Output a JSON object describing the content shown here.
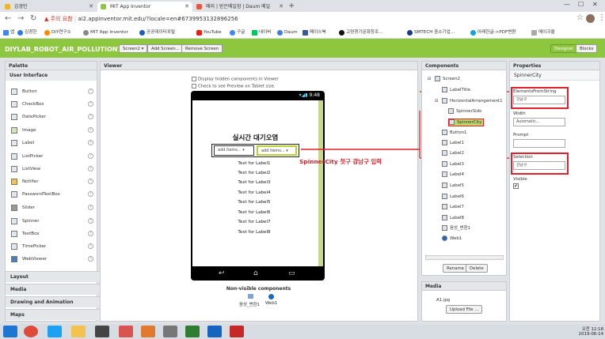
{
  "browser": {
    "tabs": [
      {
        "label": "김경민"
      },
      {
        "label": "MIT App Inventor"
      },
      {
        "label": "메러 | 받은메일함 | Daum 메일"
      }
    ],
    "new_tab": "+",
    "address_warning": "▲ 주의 요함",
    "address_url": "ai2.appinventor.mit.edu/?locale=en#6739953132896256",
    "bookmarks": [
      "앱",
      "김경한",
      "DIY연구소",
      "MIT App Inventor",
      "공공데이터포털",
      "YouTube",
      "구글",
      "네이버",
      "Daum",
      "페이스북",
      "고양경기문화창조...",
      "SMTECH 중소기업...",
      "아래한글->PDF변환",
      "메이크올"
    ]
  },
  "app": {
    "project_title": "DIYLAB_ROBOT_AIR_POLLUTION1",
    "screen_btn": "Screen2 ▾",
    "add_screen": "Add Screen...",
    "remove_screen": "Remove Screen",
    "designer": "Designer",
    "blocks": "Blocks"
  },
  "palette": {
    "title": "Palette",
    "section": "User Interface",
    "items": [
      "Button",
      "CheckBox",
      "DatePicker",
      "Image",
      "Label",
      "ListPicker",
      "ListView",
      "Notifier",
      "PasswordTextBox",
      "Slider",
      "Spinner",
      "TextBox",
      "TimePicker",
      "WebViewer"
    ],
    "categories": [
      "Layout",
      "Media",
      "Drawing and Animation",
      "Maps"
    ],
    "help": "?"
  },
  "viewer": {
    "title": "Viewer",
    "opt1": "Display hidden components in Viewer",
    "opt2": "Check to see Preview on Tablet size.",
    "status_time": "9:48",
    "screen_title": "실시간 대기오염",
    "spinner1": "add items... ▾",
    "spinner2": "add items... ▾",
    "labels": [
      "Text for Label1",
      "Text for Label2",
      "Text for Label3",
      "Text for Label4",
      "Text for Label5",
      "Text for Label6",
      "Text for Label7",
      "Text for Label8"
    ],
    "nonvisible_title": "Non-visible components",
    "nonvisible": [
      "음성_변환1",
      "Web1"
    ],
    "annotation": "SpinnerCity 첫구 강남구 입력"
  },
  "components": {
    "title": "Components",
    "tree": [
      {
        "label": "Screen2"
      },
      {
        "label": "LabelTitle"
      },
      {
        "label": "HorizontalArrangement1"
      },
      {
        "label": "SpinnerSido"
      },
      {
        "label": "SpinnerCity"
      },
      {
        "label": "Button1"
      },
      {
        "label": "Label1"
      },
      {
        "label": "Label2"
      },
      {
        "label": "Label3"
      },
      {
        "label": "Label4"
      },
      {
        "label": "Label5"
      },
      {
        "label": "Label6"
      },
      {
        "label": "Label7"
      },
      {
        "label": "Label8"
      },
      {
        "label": "음성_변환1"
      },
      {
        "label": "Web1"
      }
    ],
    "rename": "Rename",
    "delete": "Delete"
  },
  "media": {
    "title": "Media",
    "file": "A1.jpg",
    "upload": "Upload File ..."
  },
  "properties": {
    "title": "Properties",
    "component": "SpinnerCity",
    "elements_label": "ElementsFromString",
    "elements_value": "강남구",
    "width_label": "Width",
    "width_value": "Automatic...",
    "prompt_label": "Prompt",
    "prompt_value": "",
    "selection_label": "Selection",
    "selection_value": "강남구",
    "visible_label": "Visible",
    "visible_check": "✔"
  },
  "taskbar": {
    "time": "오전 12:18",
    "date": "2019-06-14"
  }
}
